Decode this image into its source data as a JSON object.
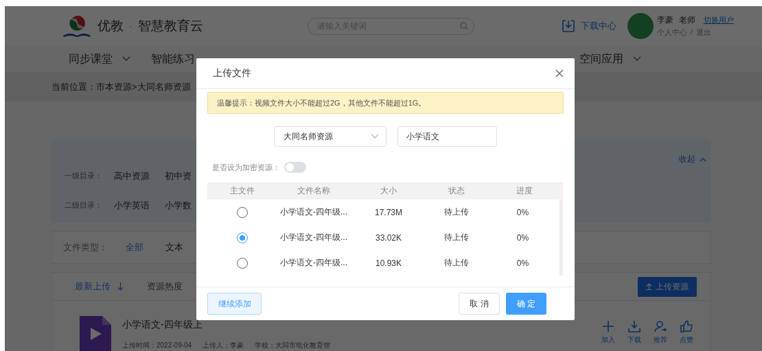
{
  "header": {
    "brand": {
      "name": "优教",
      "separator": "·",
      "subtitle": "智慧教育云"
    },
    "search": {
      "placeholder": "请输入关键词"
    },
    "download_center": "下载中心",
    "user": {
      "name": "李豪",
      "role": "老师",
      "switch_user": "切换用户",
      "profile": "个人中心",
      "separator": "/",
      "logout": "退出"
    }
  },
  "nav": [
    {
      "label": "同步课堂",
      "dropdown": true
    },
    {
      "label": "智能练习",
      "dropdown": false
    },
    {
      "label": "空间应用",
      "dropdown": true
    }
  ],
  "breadcrumb": "当前位置：市本资源>大同名师资源",
  "filters": {
    "collapse": "收起",
    "rows": [
      {
        "label": "一级目录：",
        "options": [
          "高中资源",
          "初中资"
        ]
      },
      {
        "label": "二级目录：",
        "options": [
          "小学英语",
          "小学数"
        ]
      }
    ]
  },
  "file_types": {
    "label": "文件类型：",
    "options": [
      {
        "label": "全部",
        "selected": true
      },
      {
        "label": "文本",
        "selected": false
      }
    ]
  },
  "sort": {
    "options": [
      {
        "label": "最新上传",
        "selected": true
      },
      {
        "label": "资源热度",
        "selected": false
      }
    ],
    "upload_button": "上传资源"
  },
  "resources": [
    {
      "title": "小学语文-四年级上",
      "uploaded": "上传时间：2022-09-04",
      "uploader": "上传人：李豪",
      "school": "学校：大同市电化教育馆",
      "actions": [
        {
          "kind": "add",
          "label": "加入"
        },
        {
          "kind": "download",
          "label": "下载"
        },
        {
          "kind": "recommend",
          "label": "推荐"
        },
        {
          "kind": "like",
          "label": "点赞"
        }
      ]
    }
  ],
  "dialog": {
    "title": "上传文件",
    "notice": "温馨提示：视频文件大小不能超过2G，其他文件不能超过1G。",
    "library": {
      "value": "大同名师资源"
    },
    "subject": {
      "value": "小学语文"
    },
    "encrypt": {
      "label": "是否设为加密资源：",
      "on": false
    },
    "columns": [
      "主文件",
      "文件名称",
      "大小",
      "状态",
      "进度"
    ],
    "files": [
      {
        "selected": false,
        "name": "小学语文-四年级...",
        "size": "17.73M",
        "status": "待上传",
        "progress": "0%"
      },
      {
        "selected": true,
        "name": "小学语文-四年级...",
        "size": "33.02K",
        "status": "待上传",
        "progress": "0%"
      },
      {
        "selected": false,
        "name": "小学语文-四年级...",
        "size": "10.93K",
        "status": "待上传",
        "progress": "0%"
      }
    ],
    "buttons": {
      "add_more": "继续添加",
      "cancel": "取 消",
      "confirm": "确 定"
    }
  }
}
